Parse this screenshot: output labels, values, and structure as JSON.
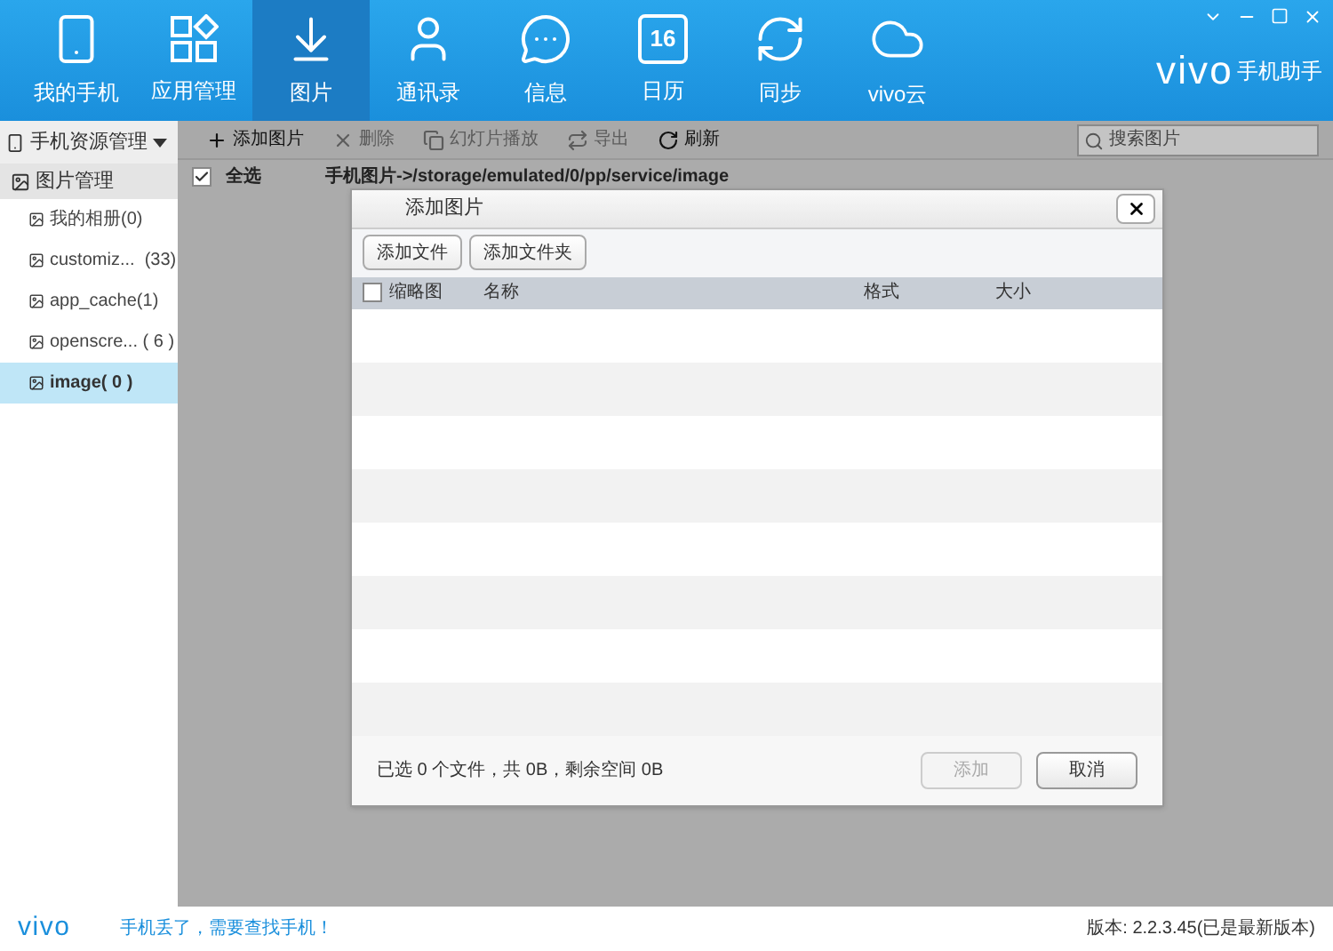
{
  "nav": [
    {
      "kind": "phone",
      "label": "我的手机",
      "selected": false
    },
    {
      "kind": "apps",
      "label": "应用管理",
      "selected": false
    },
    {
      "kind": "download",
      "label": "图片",
      "selected": true
    },
    {
      "kind": "contacts",
      "label": "通讯录",
      "selected": false
    },
    {
      "kind": "message",
      "label": "信息",
      "selected": false
    },
    {
      "kind": "calendar",
      "label": "日历",
      "selected": false,
      "icon_text": "16"
    },
    {
      "kind": "sync",
      "label": "同步",
      "selected": false
    },
    {
      "kind": "cloud",
      "label": "vivo云",
      "selected": false
    }
  ],
  "brand": {
    "logo": "vivo",
    "suffix": "手机助手"
  },
  "sidebar": {
    "title": "手机资源管理",
    "groups": [
      {
        "label": "图片管理",
        "children": [
          {
            "label": "我的相册(0)",
            "selected": false
          },
          {
            "label": "customiz...  (33)",
            "selected": false
          },
          {
            "label": "app_cache(1)",
            "selected": false
          },
          {
            "label": "openscre... ( 6 )",
            "selected": false
          },
          {
            "label": "image( 0 )",
            "selected": true
          }
        ]
      }
    ]
  },
  "toolbar": [
    {
      "kind": "add",
      "label": "添加图片",
      "disabled": false
    },
    {
      "kind": "delete",
      "label": "删除",
      "disabled": true
    },
    {
      "kind": "slideshow",
      "label": "幻灯片播放",
      "disabled": true
    },
    {
      "kind": "export",
      "label": "导出",
      "disabled": true
    },
    {
      "kind": "refresh",
      "label": "刷新",
      "disabled": false
    }
  ],
  "search": {
    "placeholder": "搜索图片"
  },
  "pathbar": {
    "select_all": {
      "label": "全选",
      "checked": true
    },
    "path": "手机图片->/storage/emulated/0/pp/service/image"
  },
  "dialog": {
    "title": "添加图片",
    "buttons_top": [
      "添加文件",
      "添加文件夹"
    ],
    "columns": [
      {
        "label": "缩略图",
        "checked": false
      },
      {
        "label": "名称"
      },
      {
        "label": "格式"
      },
      {
        "label": "大小"
      }
    ],
    "summary": "已选 0 个文件，共 0B，剩余空间 0B",
    "actions": [
      {
        "label": "添加",
        "disabled": true
      },
      {
        "label": "取消",
        "disabled": false
      }
    ]
  },
  "status_bar": {
    "logo": "vivo",
    "link": "手机丢了，需要查找手机！",
    "version": "版本: 2.2.3.45(已是最新版本)"
  }
}
